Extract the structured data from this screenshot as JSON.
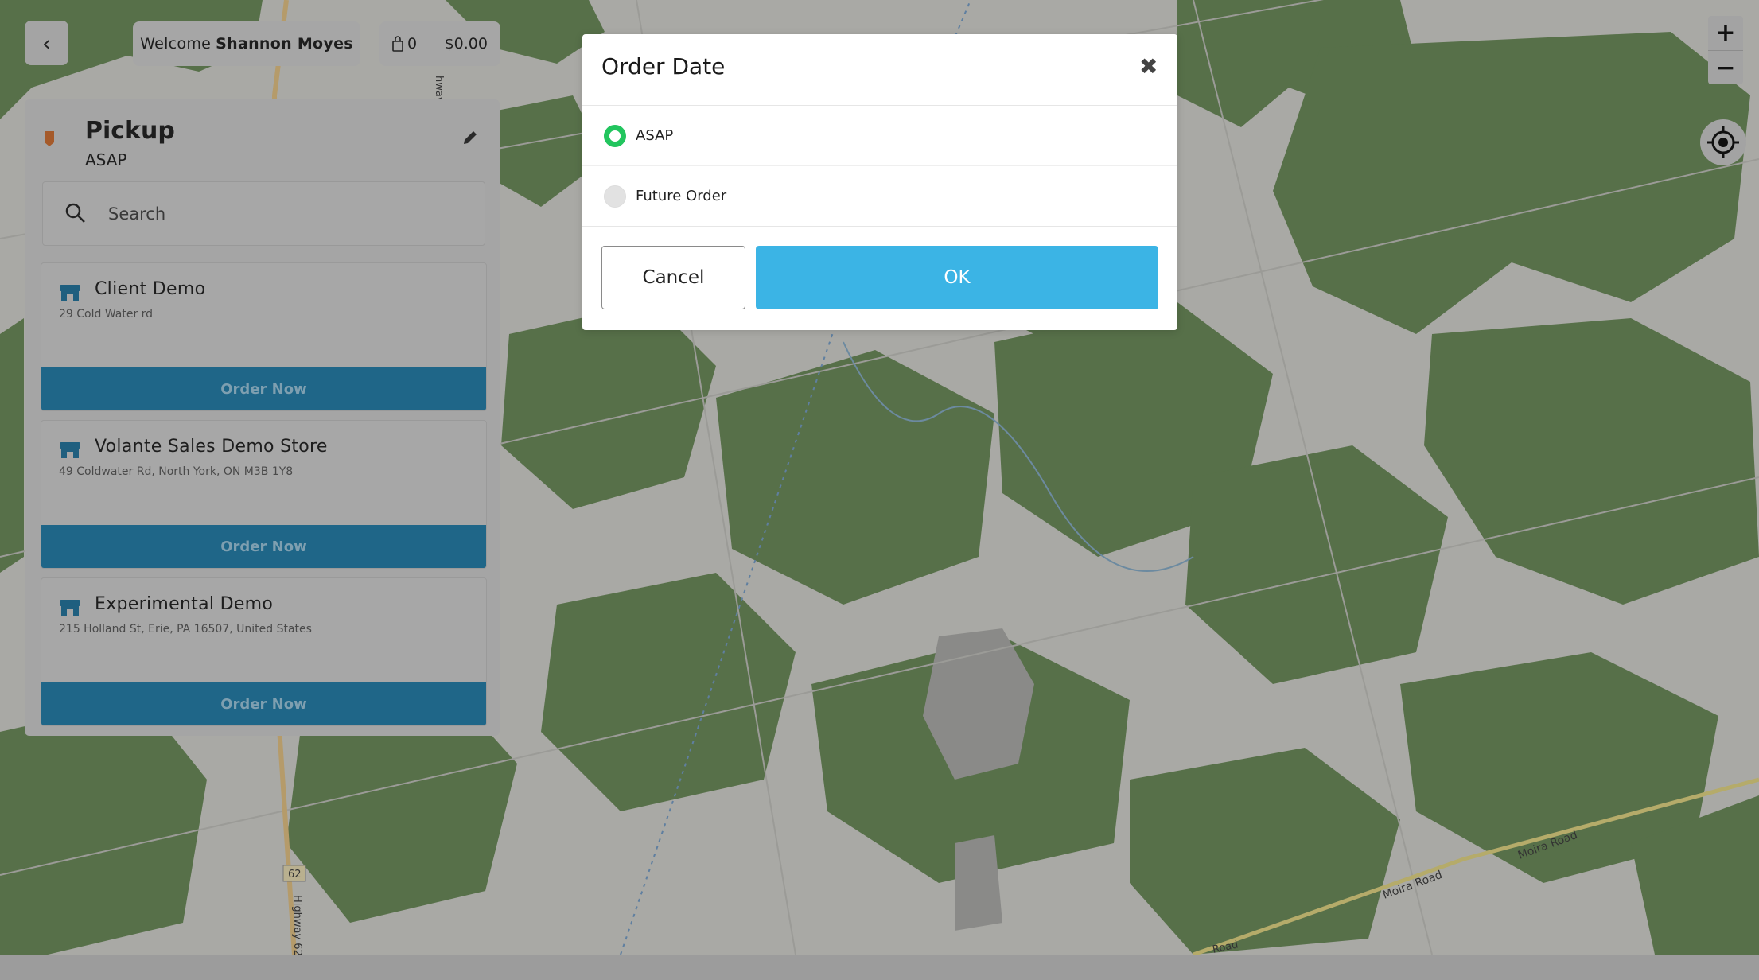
{
  "header": {
    "back_icon": "chevron-left-icon",
    "welcome_prefix": "Welcome",
    "user_name": "Shannon Moyes",
    "cart_count": "0",
    "cart_total": "$0.00"
  },
  "panel": {
    "title": "Pickup",
    "subtitle": "ASAP",
    "search_placeholder": "Search",
    "stores": [
      {
        "name": "Client Demo",
        "address": "29 Cold Water rd",
        "button": "Order Now"
      },
      {
        "name": "Volante Sales Demo Store",
        "address": "49 Coldwater Rd, North York, ON M3B 1Y8",
        "button": "Order Now"
      },
      {
        "name": "Experimental Demo",
        "address": "215 Holland St, Erie, PA 16507, United States",
        "button": "Order Now"
      }
    ]
  },
  "map": {
    "zoom_in": "+",
    "zoom_out": "−",
    "road_labels": [
      "Moira Road",
      "Moira Road",
      "Highway 62",
      "62",
      "Road",
      "hway"
    ]
  },
  "modal": {
    "title": "Order Date",
    "close": "✖",
    "options": [
      {
        "label": "ASAP",
        "selected": true
      },
      {
        "label": "Future Order",
        "selected": false
      }
    ],
    "cancel": "Cancel",
    "ok": "OK"
  },
  "colors": {
    "forest": "#577049",
    "open_land": "#a9a9a5",
    "order_button": "#1f6688",
    "ok_button": "#3bb4e5",
    "radio_selected": "#22c55e"
  }
}
